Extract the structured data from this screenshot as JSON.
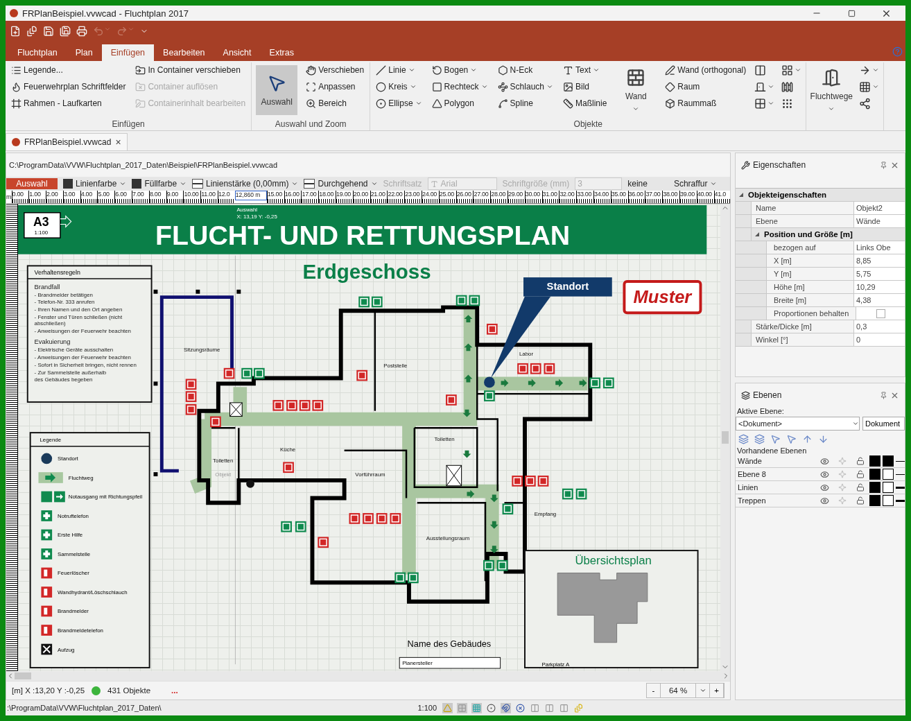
{
  "window": {
    "title": "FRPlanBeispiel.vvwcad - Fluchtplan 2017"
  },
  "menu_tabs": [
    {
      "label": "Fluchtplan",
      "selected": false
    },
    {
      "label": "Plan",
      "selected": false
    },
    {
      "label": "Einfügen",
      "selected": true
    },
    {
      "label": "Bearbeiten",
      "selected": false
    },
    {
      "label": "Ansicht",
      "selected": false
    },
    {
      "label": "Extras",
      "selected": false
    }
  ],
  "ribbon": {
    "groups": [
      {
        "label": "Einfügen",
        "columns": [
          [
            {
              "label": "Legende...",
              "kind": "small",
              "dropdown": false,
              "disabled": false
            },
            {
              "label": "Feuerwehrplan  Schriftfelder",
              "kind": "small",
              "dropdown": false,
              "disabled": false
            },
            {
              "label": "Rahmen - Laufkarten",
              "kind": "small",
              "dropdown": false,
              "disabled": false
            }
          ],
          [
            {
              "label": "In Container verschieben",
              "kind": "small",
              "dropdown": false,
              "disabled": false
            },
            {
              "label": "Container auflösen",
              "kind": "small",
              "dropdown": false,
              "disabled": true
            },
            {
              "label": "Containerinhalt bearbeiten",
              "kind": "small",
              "dropdown": false,
              "disabled": true
            }
          ]
        ]
      },
      {
        "label": "Auswahl und Zoom",
        "columns": [
          [
            {
              "label": "Auswahl",
              "kind": "large",
              "dropdown": false,
              "disabled": false,
              "selected": true
            }
          ],
          [
            {
              "label": "Verschieben",
              "kind": "small",
              "dropdown": false,
              "disabled": false
            },
            {
              "label": "Anpassen",
              "kind": "small",
              "dropdown": false,
              "disabled": false
            },
            {
              "label": "Bereich",
              "kind": "small",
              "dropdown": false,
              "disabled": false
            }
          ]
        ]
      },
      {
        "label": "Objekte",
        "columns": [
          [
            {
              "label": "Linie",
              "kind": "small",
              "dropdown": true,
              "disabled": false
            },
            {
              "label": "Kreis",
              "kind": "small",
              "dropdown": true,
              "disabled": false
            },
            {
              "label": "Ellipse",
              "kind": "small",
              "dropdown": true,
              "disabled": false
            }
          ],
          [
            {
              "label": "Bogen",
              "kind": "small",
              "dropdown": true,
              "disabled": false
            },
            {
              "label": "Rechteck",
              "kind": "small",
              "dropdown": true,
              "disabled": false
            },
            {
              "label": "Polygon",
              "kind": "small",
              "dropdown": false,
              "disabled": false
            }
          ],
          [
            {
              "label": "N-Eck",
              "kind": "small",
              "dropdown": false,
              "disabled": false
            },
            {
              "label": "Schlauch",
              "kind": "small",
              "dropdown": true,
              "disabled": false
            },
            {
              "label": "Spline",
              "kind": "small",
              "dropdown": false,
              "disabled": false
            }
          ],
          [
            {
              "label": "Text",
              "kind": "small",
              "dropdown": true,
              "disabled": false
            },
            {
              "label": "Bild",
              "kind": "small",
              "dropdown": false,
              "disabled": false
            },
            {
              "label": "Maßlinie",
              "kind": "small",
              "dropdown": false,
              "disabled": false
            }
          ],
          [
            {
              "label": "Wand",
              "kind": "large",
              "dropdown": true,
              "disabled": false,
              "selected": false
            }
          ],
          [
            {
              "label": "Wand (orthogonal)",
              "kind": "small",
              "dropdown": false,
              "disabled": false
            },
            {
              "label": "Raum",
              "kind": "small",
              "dropdown": false,
              "disabled": false
            },
            {
              "label": "Raummaß",
              "kind": "small",
              "dropdown": false,
              "disabled": false
            }
          ],
          [
            {
              "kind": "icon",
              "dropdown": false,
              "disabled": false
            },
            {
              "kind": "icon",
              "dropdown": true,
              "disabled": false
            },
            {
              "kind": "icon",
              "dropdown": true,
              "disabled": false
            }
          ],
          [
            {
              "kind": "icon",
              "dropdown": true,
              "disabled": false
            },
            {
              "kind": "icon",
              "dropdown": false,
              "disabled": false
            },
            {
              "kind": "icon",
              "dropdown": false,
              "disabled": false
            }
          ]
        ]
      },
      {
        "columns": [
          [
            {
              "label": "Fluchtwege",
              "kind": "large",
              "dropdown": true,
              "disabled": false,
              "selected": false
            }
          ],
          [
            {
              "kind": "icon",
              "dropdown": true,
              "disabled": false
            },
            {
              "kind": "icon",
              "dropdown": true,
              "disabled": false
            },
            {
              "kind": "icon",
              "dropdown": false,
              "disabled": false
            }
          ]
        ]
      }
    ]
  },
  "document_tab": {
    "label": "FRPlanBeispiel.vvwcad",
    "close": "×"
  },
  "path": "C:\\ProgramData\\VVW\\Fluchtplan_2017_Daten\\Beispiel\\FRPlanBeispiel.vvwcad",
  "format_bar": {
    "mode": "Auswahl",
    "line_color": "Linienfarbe",
    "fill_color": "Füllfarbe",
    "line_width": "Linienstärke (0,00mm)",
    "line_style": "Durchgehend",
    "font_label": "Schriftsatz",
    "font": "Arial",
    "size_label": "Schriftgröße (mm)",
    "size": "3",
    "hatch_value": "keine",
    "hatch": "Schraffur"
  },
  "ruler": {
    "unit": "m",
    "ticks_before": [
      "0.00",
      "1.00",
      "2.00",
      "3.00",
      "4.00",
      "5.00",
      "6.00",
      "7.00",
      "8.00",
      "9.00",
      "10.00",
      "11.00",
      "12.0"
    ],
    "marker": "12,860 m",
    "ticks_after": [
      "15.00",
      "16.00",
      "17.00",
      "18.00",
      "19.00",
      "20.00",
      "21.00",
      "22.00",
      "23.00",
      "24.00",
      "25.00",
      "26.00",
      "27.00",
      "28.00",
      "29.00",
      "30.00",
      "31.00",
      "32.00",
      "33.00",
      "34.00",
      "35.00",
      "36.00",
      "37.00",
      "38.00",
      "39.00",
      "40.00",
      "41.0"
    ]
  },
  "plan": {
    "title": "FLUCHT- UND RETTUNGSPLAN",
    "paper": "A3",
    "scale": "1:100",
    "floor": "Erdgeschoss",
    "location_label": "Standort",
    "stamp": "Muster",
    "cursor_tip": [
      "Auswahl",
      "X: 13,19 Y: -0,25"
    ],
    "rooms": [
      "Sitzungsräume",
      "Poststelle",
      "Labor",
      "Toiletten",
      "Küche",
      "Toiletten",
      "Objekt",
      "Vorführraum",
      "Ausstellungsraum",
      "Empfang"
    ],
    "rules": {
      "title": "Verhaltensregeln",
      "sections": [
        {
          "heading": "Brandfall",
          "items": [
            "- Brandmelder betätigen",
            "- Telefon-Nr. 333 anrufen",
            "- Ihren Namen und den Ort angeben",
            "- Fenster und Türen schließen (nicht abschließen)",
            "- Anweisungen der Feuerwehr beachten"
          ]
        },
        {
          "heading": "Evakuierung",
          "items": [
            "- Elektrische Geräte ausschalten",
            "- Anweisungen der Feuerwehr beachten",
            "- Sofort in Sicherheit bringen, nicht rennen",
            "- Zur Sammelstelle außerhalb",
            "des Gebäudes begeben"
          ]
        }
      ]
    },
    "legend": {
      "title": "Legende",
      "items": [
        {
          "label": "Standort",
          "kind": "location"
        },
        {
          "label": "Fluchtweg",
          "kind": "route"
        },
        {
          "label": "Notausgang mit Richtungspfeil",
          "kind": "exit"
        },
        {
          "label": "Notruftelefon",
          "kind": "green"
        },
        {
          "label": "Erste Hilfe",
          "kind": "green"
        },
        {
          "label": "Sammelstelle",
          "kind": "green"
        },
        {
          "label": "Feuerlöscher",
          "kind": "red"
        },
        {
          "label": "Wandhydrant/Löschschlauch",
          "kind": "red"
        },
        {
          "label": "Brandmelder",
          "kind": "red"
        },
        {
          "label": "Brandmeldetelefon",
          "kind": "red"
        },
        {
          "label": "Aufzug",
          "kind": "lift"
        }
      ]
    },
    "overview": {
      "title": "Übersichtsplan",
      "parking": "Parkplatz A"
    },
    "building_name": "Name des Gebäudes",
    "planner": "Planersteller"
  },
  "properties": {
    "title": "Eigenschaften",
    "rows": [
      {
        "label": "Objekteigenschaften",
        "expanded": true,
        "children": [
          {
            "label": "Name",
            "value": "Objekt2"
          },
          {
            "label": "Ebene",
            "value": "Wände"
          },
          {
            "label": "Position und Größe [m]",
            "expanded": true,
            "children": [
              {
                "label": "bezogen auf",
                "value": "Links Obe"
              },
              {
                "label": "X [m]",
                "value": "8,85"
              },
              {
                "label": "Y [m]",
                "value": "5,75"
              },
              {
                "label": "Höhe [m]",
                "value": "10,29"
              },
              {
                "label": "Breite [m]",
                "value": "4,38"
              },
              {
                "label": "Proportionen behalten",
                "checked": false
              }
            ]
          },
          {
            "label": "Stärke/Dicke [m]",
            "value": "0,3"
          },
          {
            "label": "Winkel [°]",
            "value": "0"
          }
        ]
      }
    ]
  },
  "layers": {
    "title": "Ebenen",
    "active_label": "Aktive Ebene:",
    "active": "<Dokument>",
    "scope": "Dokument",
    "list_label": "Vorhandene Ebenen",
    "items": [
      {
        "name": "Wände",
        "visible": true,
        "color": "#000000",
        "kind": "thin"
      },
      {
        "name": "Ebene 8",
        "visible": true,
        "color": "#ffffff",
        "kind": "thin"
      },
      {
        "name": "Linien",
        "visible": true,
        "color": "#ffffff",
        "kind": "thick"
      },
      {
        "name": "Treppen",
        "visible": true,
        "color": "#ffffff",
        "kind": "thick"
      }
    ]
  },
  "status": {
    "coords": "[m] X :13,20 Y :-0,25",
    "objects": "431 Objekte",
    "more": "...",
    "zoom_out": "-",
    "zoom": "64 %",
    "zoom_in": "+"
  },
  "bottom_bar": {
    "path": ":\\ProgramData\\VVW\\Fluchtplan_2017_Daten\\",
    "scale": "1:100"
  }
}
